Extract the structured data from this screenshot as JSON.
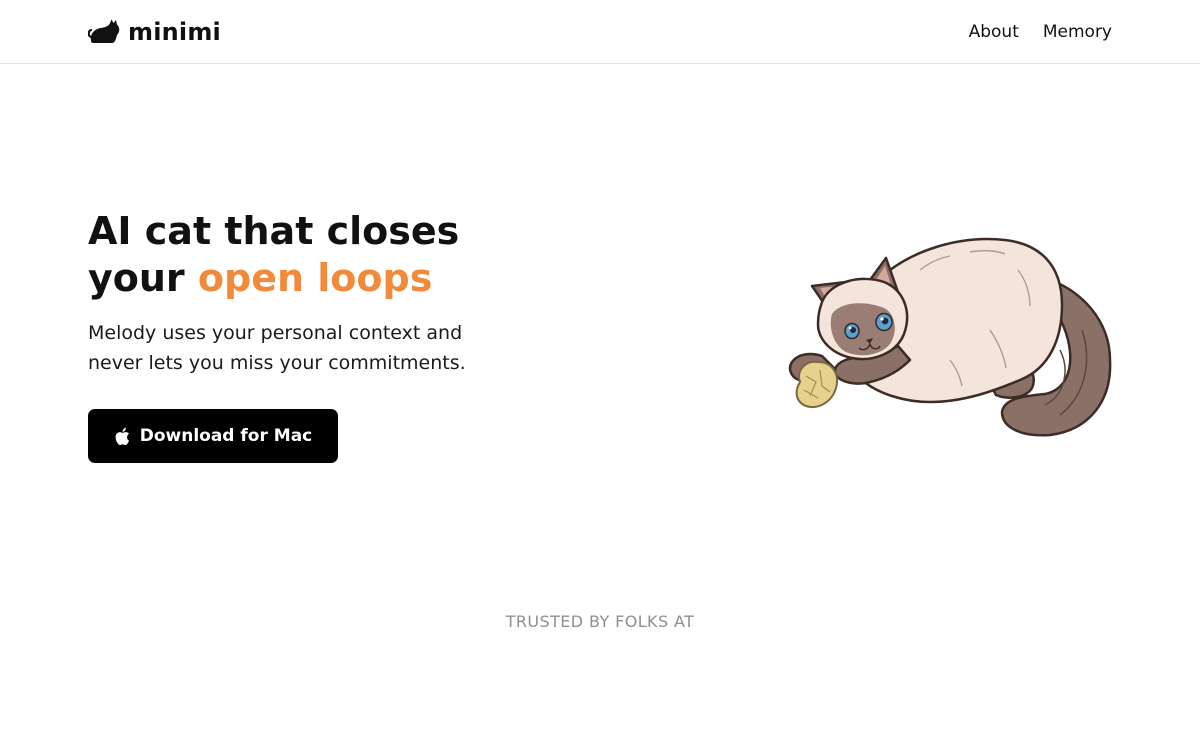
{
  "brand": {
    "name": "minimi",
    "logo_icon": "cat-silhouette-icon"
  },
  "nav": {
    "items": [
      {
        "label": "About"
      },
      {
        "label": "Memory"
      }
    ]
  },
  "hero": {
    "title_line1": "AI cat that closes",
    "title_line2_prefix": "your ",
    "title_line2_accent": "open loops",
    "subtitle": "Melody uses your personal context and never lets you miss your commitments.",
    "cta_label": "Download for Mac",
    "cta_icon": "apple-icon",
    "illustration": "cat-playing-with-paper-ball-illustration"
  },
  "trusted": {
    "label": "TRUSTED BY FOLKS AT"
  },
  "colors": {
    "accent": "#f28a3c",
    "text": "#111111",
    "muted": "#8f8f8f",
    "button_bg": "#000000",
    "button_text": "#ffffff",
    "divider": "#e2e2e2"
  }
}
